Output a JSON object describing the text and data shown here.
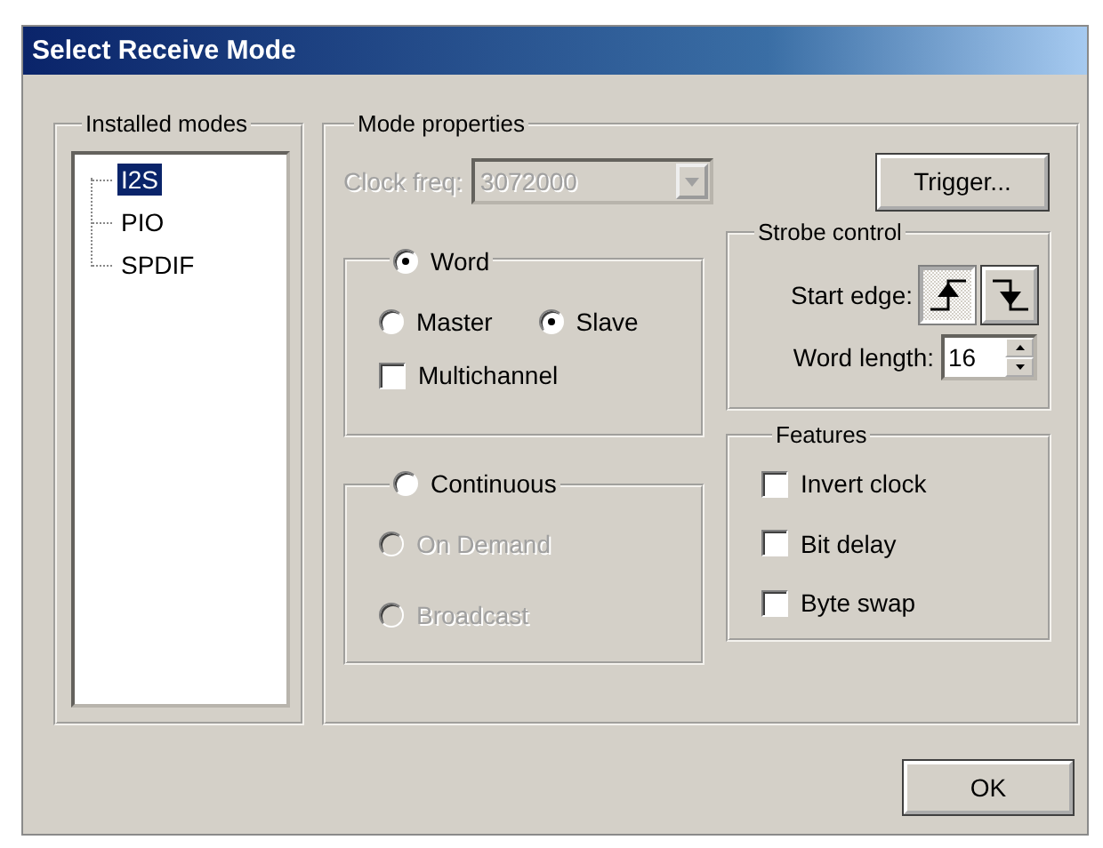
{
  "window": {
    "title": "Select Receive Mode"
  },
  "installed_modes": {
    "title": "Installed modes",
    "items": [
      {
        "label": "I2S",
        "selected": true
      },
      {
        "label": "PIO",
        "selected": false
      },
      {
        "label": "SPDIF",
        "selected": false
      }
    ]
  },
  "mode_properties": {
    "title": "Mode properties",
    "clock_freq": {
      "label": "Clock freq:",
      "value": "3072000",
      "disabled": true
    },
    "trigger_button": "Trigger...",
    "word_group": {
      "label": "Word",
      "selected": true,
      "options": [
        {
          "label": "Master",
          "selected": false,
          "disabled": false
        },
        {
          "label": "Slave",
          "selected": true,
          "disabled": false
        }
      ],
      "multichannel": {
        "label": "Multichannel",
        "checked": false
      }
    },
    "continuous_group": {
      "label": "Continuous",
      "selected": false,
      "options": [
        {
          "label": "On Demand",
          "selected": false,
          "disabled": true
        },
        {
          "label": "Broadcast",
          "selected": false,
          "disabled": true
        }
      ]
    },
    "strobe_control": {
      "title": "Strobe control",
      "start_edge": {
        "label": "Start edge:",
        "buttons": [
          {
            "kind": "rising",
            "selected": true
          },
          {
            "kind": "falling",
            "selected": false
          }
        ]
      },
      "word_length": {
        "label": "Word length:",
        "value": "16"
      }
    },
    "features": {
      "title": "Features",
      "items": [
        {
          "label": "Invert clock",
          "checked": false
        },
        {
          "label": "Bit delay",
          "checked": false
        },
        {
          "label": "Byte swap",
          "checked": false
        }
      ]
    }
  },
  "ok_button": "OK"
}
